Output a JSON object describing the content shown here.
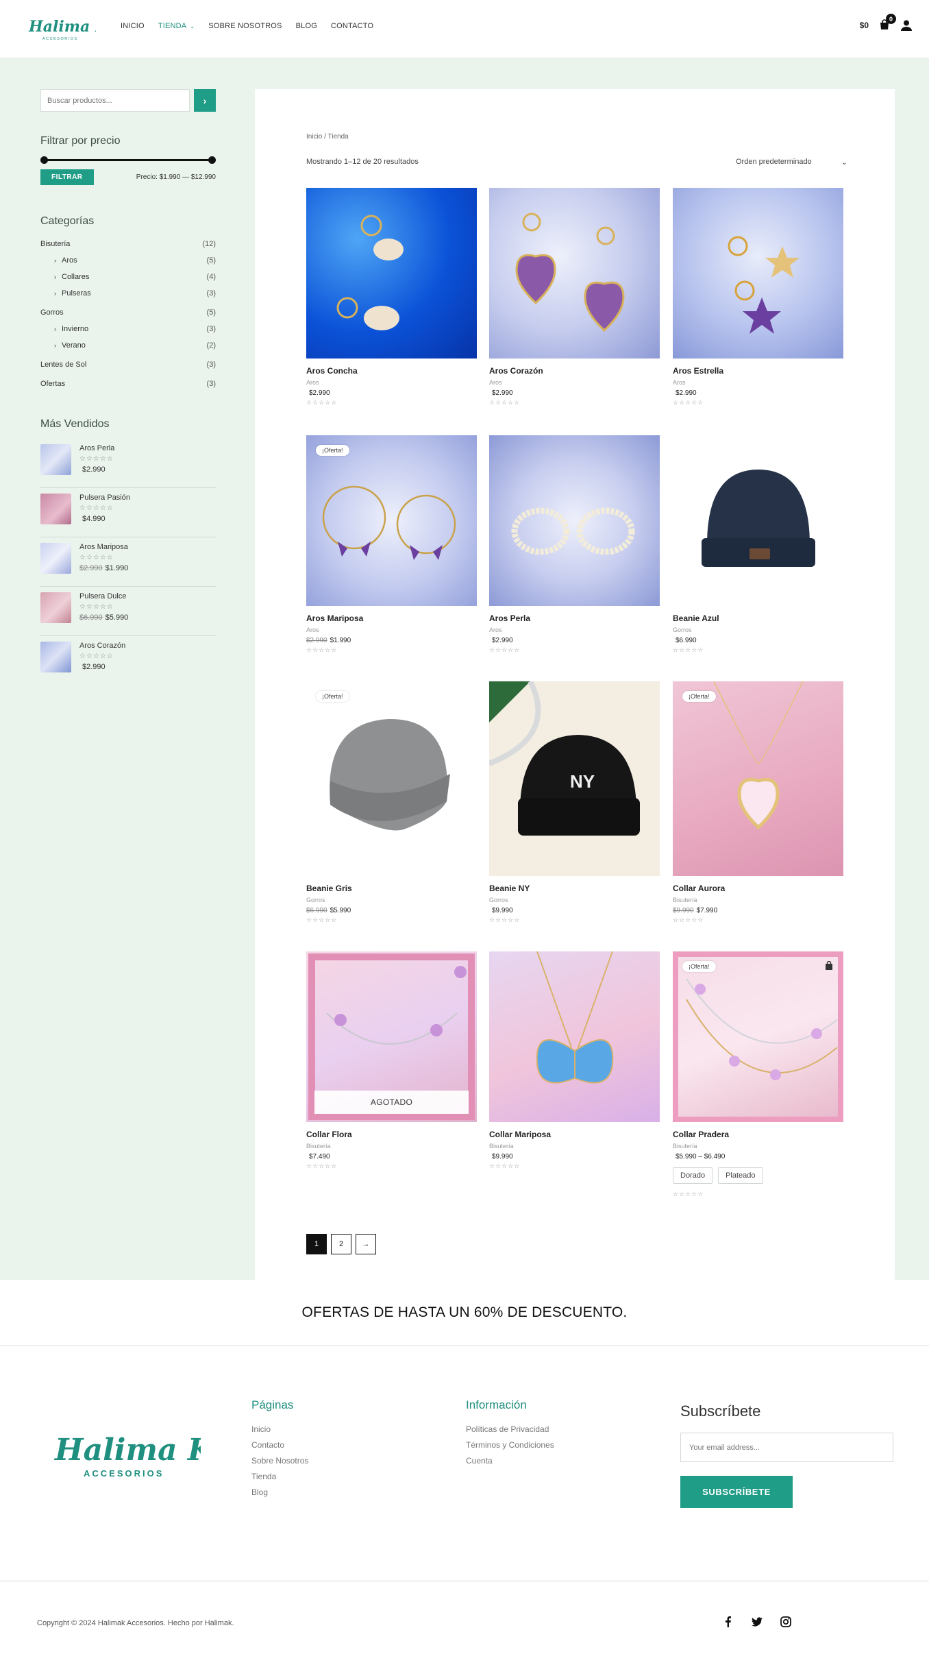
{
  "header": {
    "logo_text": "Halima K",
    "logo_sub": "ACCESORIOS",
    "nav": [
      {
        "label": "INICIO"
      },
      {
        "label": "TIENDA"
      },
      {
        "label": "SOBRE NOSOTROS"
      },
      {
        "label": "BLOG"
      },
      {
        "label": "CONTACTO"
      }
    ],
    "cart_total": "$0",
    "cart_count": "0"
  },
  "sidebar": {
    "search_placeholder": "Buscar productos...",
    "price_title": "Filtrar por precio",
    "filter_label": "FILTRAR",
    "price_range": "Precio: $1.990 — $12.990",
    "categories_title": "Categorías",
    "categories": [
      {
        "label": "Bisutería",
        "count": "(12)"
      },
      {
        "label": "Aros",
        "count": "(5)"
      },
      {
        "label": "Collares",
        "count": "(4)"
      },
      {
        "label": "Pulseras",
        "count": "(3)"
      },
      {
        "label": "Gorros",
        "count": "(5)"
      },
      {
        "label": "Invierno",
        "count": "(3)"
      },
      {
        "label": "Verano",
        "count": "(2)"
      },
      {
        "label": "Lentes de Sol",
        "count": "(3)"
      },
      {
        "label": "Ofertas",
        "count": "(3)"
      }
    ],
    "best_title": "Más Vendidos",
    "best_sellers": [
      {
        "name": "Aros Perla",
        "old": "",
        "price": "$2.990"
      },
      {
        "name": "Pulsera Pasión",
        "old": "",
        "price": "$4.990"
      },
      {
        "name": "Aros Mariposa",
        "old": "$2.990",
        "price": "$1.990"
      },
      {
        "name": "Pulsera Dulce",
        "old": "$6.990",
        "price": "$5.990"
      },
      {
        "name": "Aros Corazón",
        "old": "",
        "price": "$2.990"
      }
    ]
  },
  "shop": {
    "breadcrumb": "Inicio / Tienda",
    "result_count": "Mostrando 1–12 de 20 resultados",
    "ordering": "Orden predeterminado",
    "sale_badge": "¡Oferta!",
    "sold_out": "AGOTADO",
    "stars": "☆☆☆☆☆",
    "products": [
      {
        "name": "Aros Concha",
        "cat": "Aros",
        "old": "",
        "price": "$2.990"
      },
      {
        "name": "Aros Corazón",
        "cat": "Aros",
        "old": "",
        "price": "$2.990"
      },
      {
        "name": "Aros Estrella",
        "cat": "Aros",
        "old": "",
        "price": "$2.990"
      },
      {
        "name": "Aros Mariposa",
        "cat": "Aros",
        "old": "$2.990",
        "price": "$1.990"
      },
      {
        "name": "Aros Perla",
        "cat": "Aros",
        "old": "",
        "price": "$2.990"
      },
      {
        "name": "Beanie Azul",
        "cat": "Gorros",
        "old": "",
        "price": "$6.990"
      },
      {
        "name": "Beanie Gris",
        "cat": "Gorros",
        "old": "$6.990",
        "price": "$5.990"
      },
      {
        "name": "Beanie NY",
        "cat": "Gorros",
        "old": "",
        "price": "$9.990"
      },
      {
        "name": "Collar Aurora",
        "cat": "Bisutería",
        "old": "$9.990",
        "price": "$7.990"
      },
      {
        "name": "Collar Flora",
        "cat": "Bisutería",
        "old": "",
        "price": "$7.490"
      },
      {
        "name": "Collar Mariposa",
        "cat": "Bisutería",
        "old": "",
        "price": "$9.990"
      },
      {
        "name": "Collar Pradera",
        "cat": "Bisutería",
        "old": "",
        "price": "$5.990 – $6.490"
      }
    ],
    "variants": [
      "Dorado",
      "Plateado"
    ],
    "pages": [
      "1",
      "2",
      "→"
    ]
  },
  "offer_text": "OFERTAS DE HASTA UN 60% DE DESCUENTO.",
  "footer": {
    "pages_title": "Páginas",
    "pages_links": [
      "Inicio",
      "Contacto",
      "Sobre Nosotros",
      "Tienda",
      "Blog"
    ],
    "info_title": "Información",
    "info_links": [
      "Políticas de Privacidad",
      "Términos y Condiciones",
      "Cuenta"
    ],
    "subscribe_title": "Subscríbete",
    "email_placeholder": "Your email address...",
    "subscribe_label": "SUBSCRÍBETE",
    "copyright": "Copyright © 2024 Halimak Accesorios. Hecho por Halimak."
  },
  "colors": {
    "accent": "#1f9d86",
    "band": "#eaf3ec"
  },
  "icons": [
    "chevron-down-icon",
    "cart-icon",
    "user-icon",
    "chevron-right-icon",
    "facebook-icon",
    "twitter-icon",
    "instagram-icon",
    "bag-icon"
  ]
}
